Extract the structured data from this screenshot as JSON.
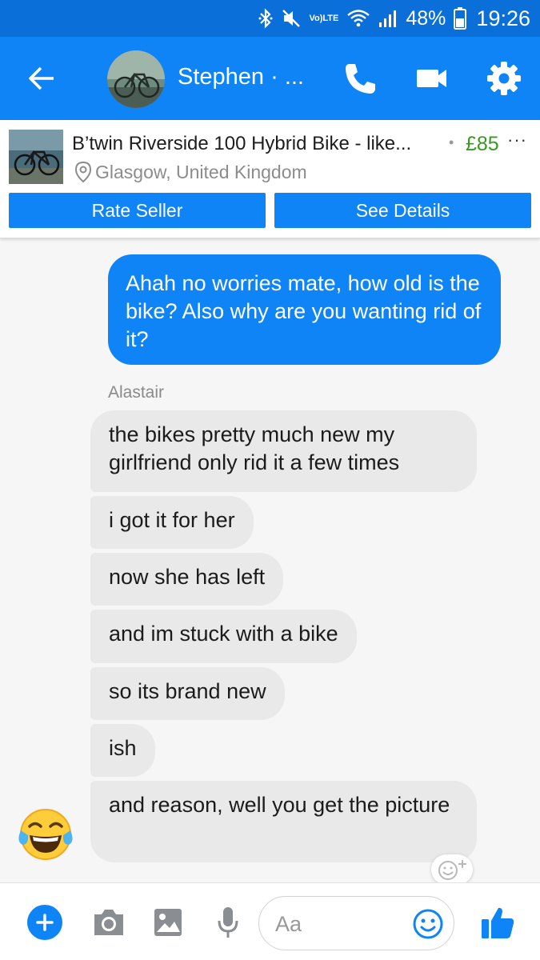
{
  "status_bar": {
    "network_label_top": "Vo)",
    "network_label_bottom": "LTE",
    "battery": "48%",
    "time": "19:26"
  },
  "header": {
    "contact_name": "Stephen · ...",
    "accent_color": "#0f84f6"
  },
  "listing": {
    "title": "B’twin Riverside 100 Hybrid Bike - like...",
    "separator": "•",
    "price": "£85",
    "more": "···",
    "location": "Glasgow, United Kingdom",
    "rate_seller_label": "Rate Seller",
    "see_details_label": "See Details",
    "price_color": "#3a9a1e"
  },
  "conversation": {
    "outgoing": [
      {
        "text": "Ahah no worries mate, how old is the bike? Also why are you wanting rid of it?"
      }
    ],
    "sender_name": "Alastair",
    "incoming": [
      {
        "text": "the bikes pretty much new my girlfriend only rid it a few times"
      },
      {
        "text": "i got it for her"
      },
      {
        "text": "now she has left"
      },
      {
        "text": "and im stuck with a bike"
      },
      {
        "text": "so its brand new"
      },
      {
        "text": "ish"
      },
      {
        "text": "and reason, well you get the picture"
      }
    ],
    "sender_avatar_icon": "tears-of-joy-emoji"
  },
  "composer": {
    "placeholder": "Aa",
    "icons": [
      "plus-icon",
      "camera-icon",
      "image-icon",
      "microphone-icon",
      "emoji-icon",
      "thumbs-up-icon"
    ]
  }
}
